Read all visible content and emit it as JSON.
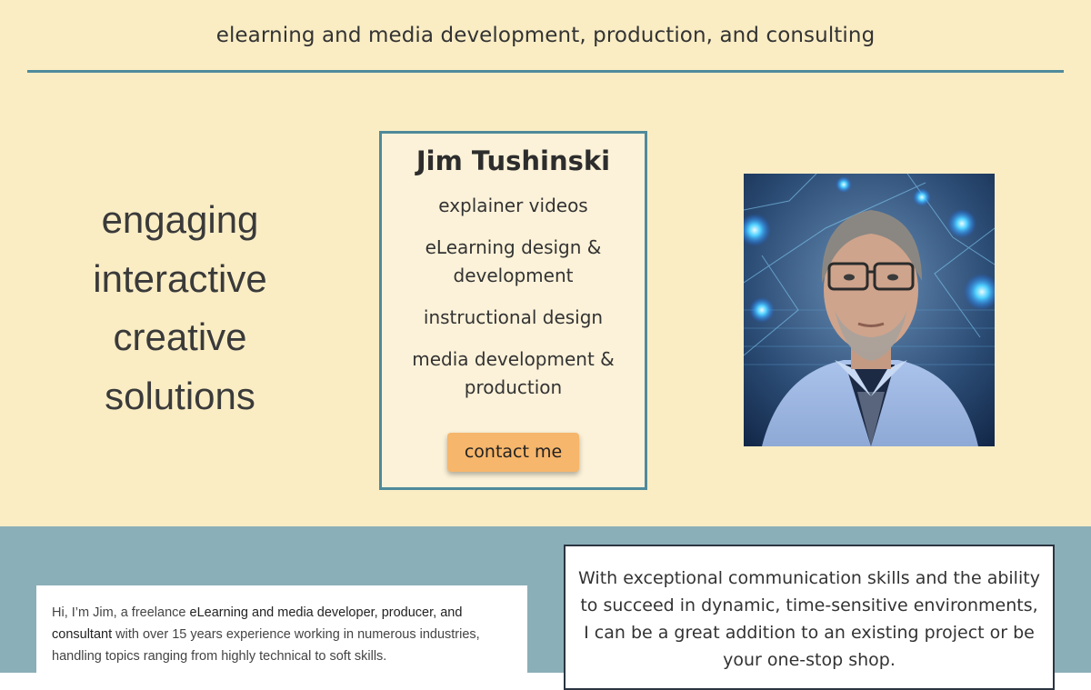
{
  "header": {
    "tagline": "elearning and media development, production, and consulting"
  },
  "hero": {
    "slogan": [
      "engaging",
      "interactive",
      "creative",
      "solutions"
    ],
    "card": {
      "name": "Jim Tushinski",
      "services": [
        "explainer videos",
        "eLearning design & development",
        "instructional design",
        "media development & production"
      ],
      "cta_label": "contact me"
    },
    "photo_alt": "Portrait of Jim Tushinski"
  },
  "about": {
    "intro_pre": "Hi, I’m Jim, a freelance ",
    "intro_bold": "eLearning and media developer, producer, and consultant",
    "intro_post": " with over 15 years experience working in numerous industries, handling topics ranging from highly technical to soft skills.",
    "pitch": "With exceptional communication skills and the ability to succeed in dynamic, time-sensitive environments, I can be a great addition to an existing project or be your one-stop shop."
  },
  "colors": {
    "cream": "#faedc4",
    "teal": "#4f8a9b",
    "button": "#f6b66b",
    "slate": "#8bafb8"
  }
}
